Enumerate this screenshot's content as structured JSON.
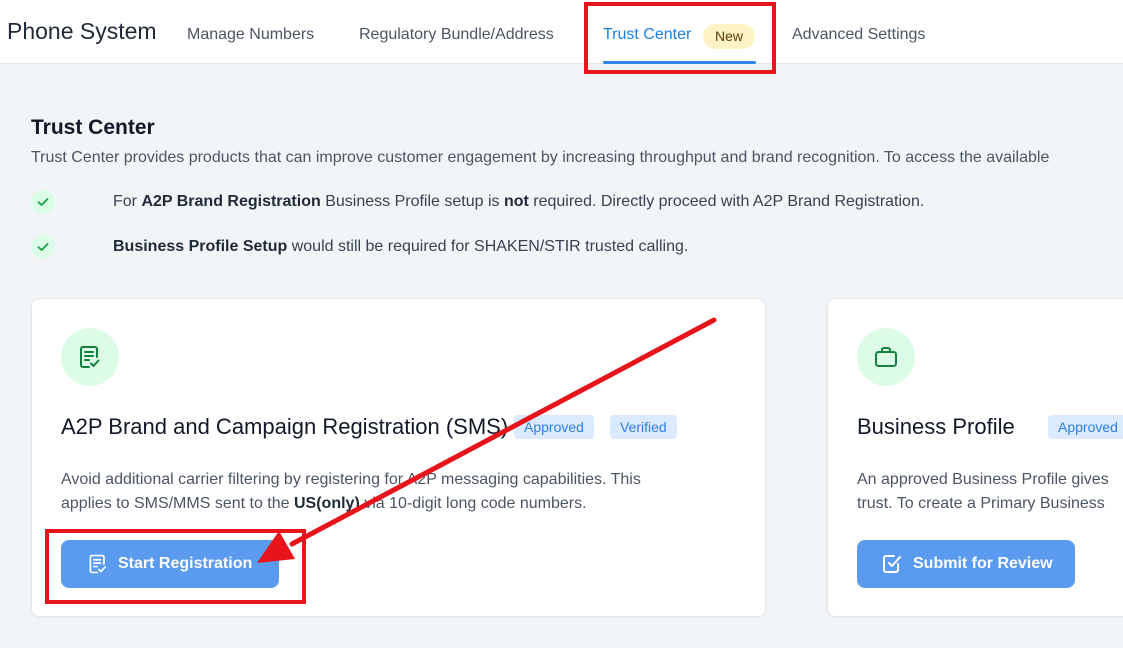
{
  "header": {
    "app_title": "Phone System",
    "tabs": [
      {
        "label": "Manage Numbers"
      },
      {
        "label": "Regulatory Bundle/Address"
      },
      {
        "label": "Trust Center",
        "badge": "New"
      },
      {
        "label": "Advanced Settings"
      }
    ],
    "active_tab": "Trust Center"
  },
  "trust_center": {
    "title": "Trust Center",
    "description": "Trust Center provides products that can improve customer engagement by increasing throughput and brand recognition. To access the available",
    "notes": [
      {
        "pre": "For ",
        "bold1": "A2P Brand Registration",
        "mid": " Business Profile setup is ",
        "bold2": "not",
        "post": " required. Directly proceed with A2P Brand Registration."
      },
      {
        "bold1": "Business Profile Setup",
        "post": " would still be required for SHAKEN/STIR trusted calling."
      }
    ]
  },
  "cards": [
    {
      "title": "A2P Brand and Campaign Registration (SMS)",
      "badges": [
        "Approved",
        "Verified"
      ],
      "desc_line1": "Avoid additional carrier filtering by registering for A2P messaging capabilities. This",
      "desc_line2_pre": "applies to SMS/MMS sent to the ",
      "desc_line2_bold": "US(only)",
      "desc_line2_post": " via 10-digit long code numbers.",
      "button": "Start Registration",
      "icon": "document-check-icon"
    },
    {
      "title": "Business Profile",
      "badges": [
        "Approved"
      ],
      "desc_line1": "An approved Business Profile gives",
      "desc_line2": "trust. To create a Primary Business",
      "button": "Submit for Review",
      "icon": "briefcase-icon"
    }
  ],
  "colors": {
    "accent": "#1d7fe0",
    "button": "#5b9bef",
    "badge_bg": "#dbeafe",
    "check_bg": "#dcfce7",
    "annotation_red": "#e8141b"
  }
}
